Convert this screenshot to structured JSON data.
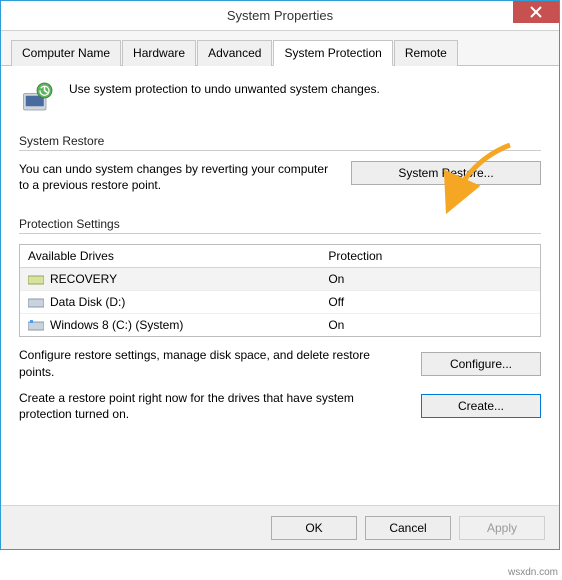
{
  "window": {
    "title": "System Properties"
  },
  "tabs": {
    "computer_name": "Computer Name",
    "hardware": "Hardware",
    "advanced": "Advanced",
    "system_protection": "System Protection",
    "remote": "Remote"
  },
  "intro": {
    "text": "Use system protection to undo unwanted system changes."
  },
  "system_restore": {
    "group_label": "System Restore",
    "description": "You can undo system changes by reverting your computer to a previous restore point.",
    "button": "System Restore..."
  },
  "protection_settings": {
    "group_label": "Protection Settings",
    "col_drive": "Available Drives",
    "col_protection": "Protection",
    "rows": [
      {
        "name": "RECOVERY",
        "protection": "On"
      },
      {
        "name": "Data Disk (D:)",
        "protection": "Off"
      },
      {
        "name": "Windows 8 (C:) (System)",
        "protection": "On"
      }
    ],
    "configure_text": "Configure restore settings, manage disk space, and delete restore points.",
    "configure_button": "Configure...",
    "create_text": "Create a restore point right now for the drives that have system protection turned on.",
    "create_button": "Create..."
  },
  "dialog": {
    "ok": "OK",
    "cancel": "Cancel",
    "apply": "Apply"
  },
  "attrib": "wsxdn.com"
}
